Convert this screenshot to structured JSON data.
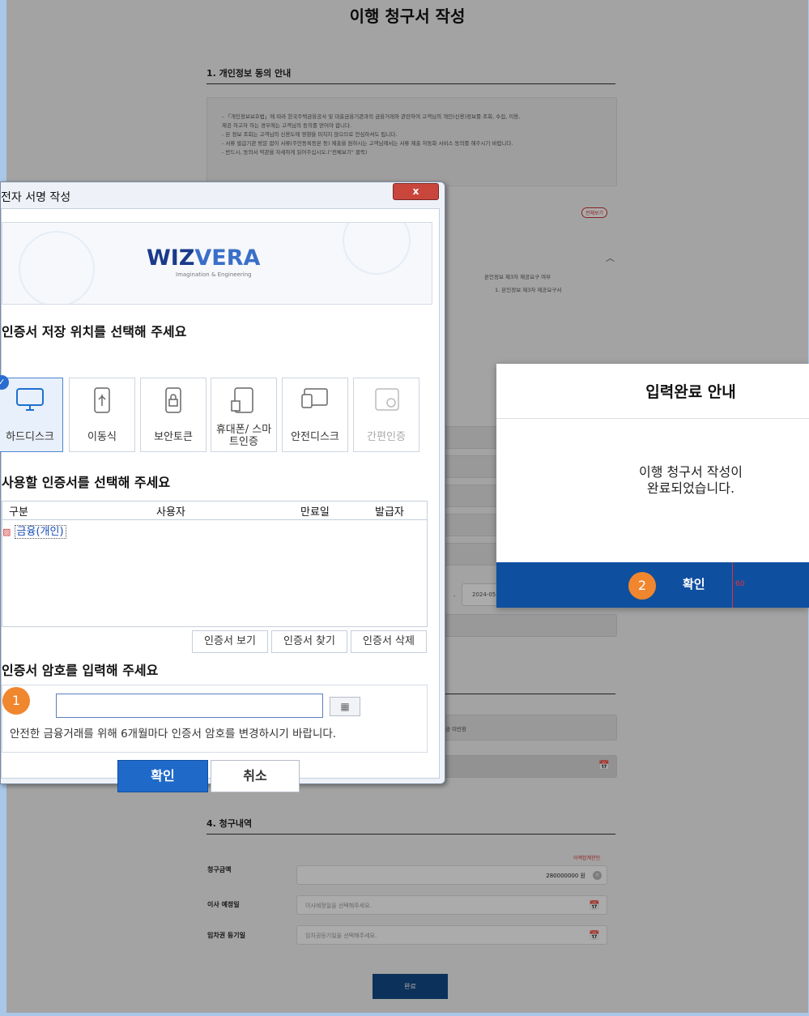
{
  "page": {
    "title": "이행 청구서 작성",
    "section1_title": "1. 개인정보 동의 안내",
    "notice": [
      "- 「개인정보보호법」에 따라 한국주택금융공사 및 대출금융기관과의 금융거래와 관련하여 고객님의 개인(신용)정보를 조회, 수집, 이용,",
      "제공 하고자 하는 경우에는 고객님의 동의를 얻어야 합니다.",
      "- 본 정보 조회는 고객님의 신용도에 영향을 미치지 않으므로 안심하셔도 됩니다.",
      "- 서류 발급기관 방문 없이 서류(주민등록등본 등) 제출을 원하시는 고객님께서는 서류 제출 자동화 서비스 동의를 해주시기 바랍니다.",
      "- 반드시, 동의서 약관을 자세하게 읽어주십시오.(\"전체보기\" 클릭)"
    ],
    "fulltext_button": "전체보기",
    "consent_item": "본인정보 제3자 제공요구 여부",
    "consent_sub": "1. 본인정보 제3자 제공요구서",
    "date_value": "2024-05-",
    "unpaid_text": "금 미반환",
    "section4_title": "4. 청구내역",
    "red_note": "이액합계한인",
    "amount_label": "청구금액",
    "amount_value": "280000000 원",
    "move_date_label": "이사 예정일",
    "move_date_placeholder": "이사예정일을 선택해주세요.",
    "lease_date_label": "임차권 등기일",
    "lease_date_placeholder": "임차권등기일을 선택해주세요.",
    "submit_button": "완료"
  },
  "dialog": {
    "title": "전자 서명 작성",
    "close_label": "x",
    "logo_main": "WIZ",
    "logo_accent": "VERA",
    "logo_sub": "Imagination & Engineering",
    "storage_heading": "인증서 저장 위치를 선택해 주세요",
    "storage_options": [
      {
        "label": "하드디스크",
        "icon": "monitor-icon"
      },
      {
        "label": "이동식",
        "icon": "usb-icon"
      },
      {
        "label": "보안토큰",
        "icon": "security-token-icon"
      },
      {
        "label": "휴대폰/ 스마트인증",
        "icon": "phone-icon"
      },
      {
        "label": "안전디스크",
        "icon": "safe-disk-icon"
      },
      {
        "label": "간편인증",
        "icon": "simple-auth-icon"
      }
    ],
    "cert_heading": "사용할 인증서를 선택해 주세요",
    "cert_columns": [
      "구분",
      "사용자",
      "만료일",
      "발급자"
    ],
    "cert_rows": [
      {
        "type": "금융(개인)",
        "user": "",
        "expiry": "",
        "issuer": ""
      }
    ],
    "cert_buttons": [
      "인증서 보기",
      "인증서 찾기",
      "인증서 삭제"
    ],
    "password_heading": "인증서 암호를 입력해 주세요",
    "password_value": "",
    "keyboard_icon": "keyboard-icon",
    "password_note": "안전한 금융거래를 위해 6개월마다 인증서 암호를 변경하시기 바랍니다.",
    "ok_button": "확인",
    "cancel_button": "취소",
    "step_badge": "1"
  },
  "modal": {
    "title": "입력완료 안내",
    "message_line1": "이행 청구서 작성이",
    "message_line2": "완료되었습니다.",
    "ok_button": "확인",
    "step_badge": "2",
    "counter": "60"
  }
}
